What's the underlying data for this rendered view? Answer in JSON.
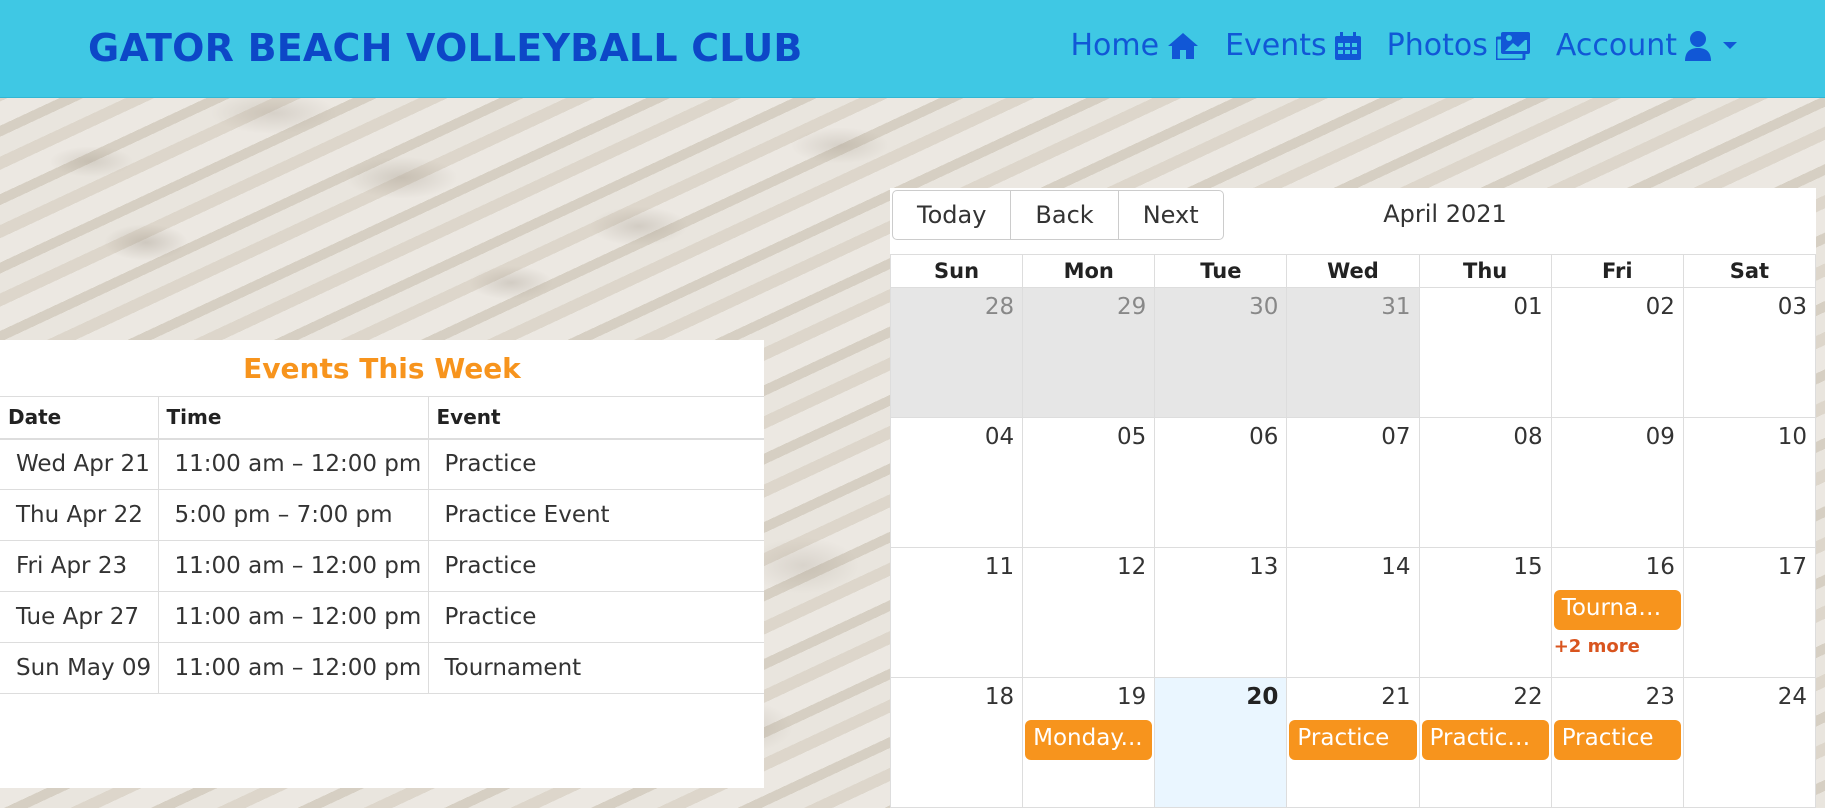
{
  "navbar": {
    "brand": "GATOR BEACH VOLLEYBALL CLUB",
    "links": [
      {
        "label": "Home",
        "icon": "home-icon"
      },
      {
        "label": "Events",
        "icon": "calendar-icon"
      },
      {
        "label": "Photos",
        "icon": "images-icon"
      },
      {
        "label": "Account",
        "icon": "user-icon"
      }
    ],
    "color": "#3fc8e4"
  },
  "events_panel": {
    "title": "Events This Week",
    "columns": [
      "Date",
      "Time",
      "Event"
    ],
    "rows": [
      {
        "date": "Wed Apr 21",
        "time": "11:00 am – 12:00 pm",
        "event": "Practice"
      },
      {
        "date": "Thu Apr 22",
        "time": "5:00 pm – 7:00 pm",
        "event": "Practice Event"
      },
      {
        "date": "Fri Apr 23",
        "time": "11:00 am – 12:00 pm",
        "event": "Practice"
      },
      {
        "date": "Tue Apr 27",
        "time": "11:00 am – 12:00 pm",
        "event": "Practice"
      },
      {
        "date": "Sun May 09",
        "time": "11:00 am – 12:00 pm",
        "event": "Tournament"
      }
    ]
  },
  "calendar": {
    "buttons": {
      "today": "Today",
      "back": "Back",
      "next": "Next"
    },
    "label": "April 2021",
    "weekdays": [
      "Sun",
      "Mon",
      "Tue",
      "Wed",
      "Thu",
      "Fri",
      "Sat"
    ],
    "days": [
      {
        "num": "28",
        "off": true
      },
      {
        "num": "29",
        "off": true
      },
      {
        "num": "30",
        "off": true
      },
      {
        "num": "31",
        "off": true
      },
      {
        "num": "01"
      },
      {
        "num": "02"
      },
      {
        "num": "03"
      },
      {
        "num": "04"
      },
      {
        "num": "05"
      },
      {
        "num": "06"
      },
      {
        "num": "07"
      },
      {
        "num": "08"
      },
      {
        "num": "09"
      },
      {
        "num": "10"
      },
      {
        "num": "11"
      },
      {
        "num": "12"
      },
      {
        "num": "13"
      },
      {
        "num": "14"
      },
      {
        "num": "15"
      },
      {
        "num": "16",
        "event": "Tournament",
        "more": "+2 more"
      },
      {
        "num": "17"
      },
      {
        "num": "18"
      },
      {
        "num": "19",
        "event": "Monday..."
      },
      {
        "num": "20",
        "today": true
      },
      {
        "num": "21",
        "event": "Practice"
      },
      {
        "num": "22",
        "event": "Practice Event"
      },
      {
        "num": "23",
        "event": "Practice"
      },
      {
        "num": "24"
      }
    ],
    "event_color": "#f7941d",
    "today_color": "#eaf6ff"
  }
}
